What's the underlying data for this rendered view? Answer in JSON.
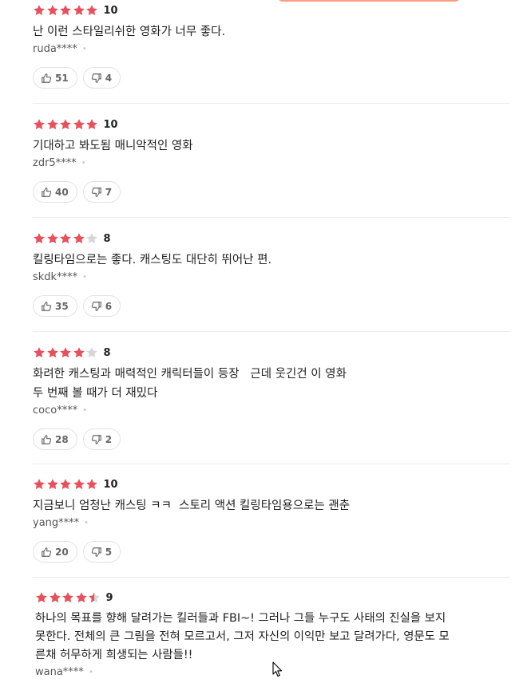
{
  "colors": {
    "star_on": "#e8505b",
    "star_off": "#d6d6d6",
    "accent_bar": "#ff9b7f"
  },
  "reviews": [
    {
      "stars": [
        1,
        1,
        1,
        1,
        1
      ],
      "score": "10",
      "text": "난 이런 스타일리쉬한 영화가 너무 좋다.",
      "user": "ruda****",
      "likes": "51",
      "dislikes": "4"
    },
    {
      "stars": [
        1,
        1,
        1,
        1,
        1
      ],
      "score": "10",
      "text": "기대하고 봐도됨 매니악적인 영화",
      "user": "zdr5****",
      "likes": "40",
      "dislikes": "7"
    },
    {
      "stars": [
        1,
        1,
        1,
        1,
        0
      ],
      "score": "8",
      "text": "킬링타임으로는 좋다. 캐스팅도 대단히 뛰어난 편.",
      "user": "skdk****",
      "likes": "35",
      "dislikes": "6"
    },
    {
      "stars": [
        1,
        1,
        1,
        1,
        0
      ],
      "score": "8",
      "text": "화려한 캐스팅과 매력적인 캐릭터들이 등장   근데 웃긴건 이 영화\n두 번째 볼 때가 더 재밌다",
      "user": "coco****",
      "likes": "28",
      "dislikes": "2"
    },
    {
      "stars": [
        1,
        1,
        1,
        1,
        1
      ],
      "score": "10",
      "text": "지금보니 엄청난 캐스팅 ㅋㅋ  스토리 액션 킬링타임용으로는 괜춘",
      "user": "yang****",
      "likes": "20",
      "dislikes": "5"
    },
    {
      "stars": [
        1,
        1,
        1,
        1,
        0.5
      ],
      "score": "9",
      "text": "하나의 목표를 향해 달려가는 킬러들과 FBI~! 그러나 그들 누구도 사태의 진실을 보지\n못한다. 전체의 큰 그림을 전혀 모르고서, 그저 자신의 이익만 보고 달려가다, 영문도 모\n른채 허무하게 희생되는 사람들!!",
      "user": "wana****"
    }
  ]
}
